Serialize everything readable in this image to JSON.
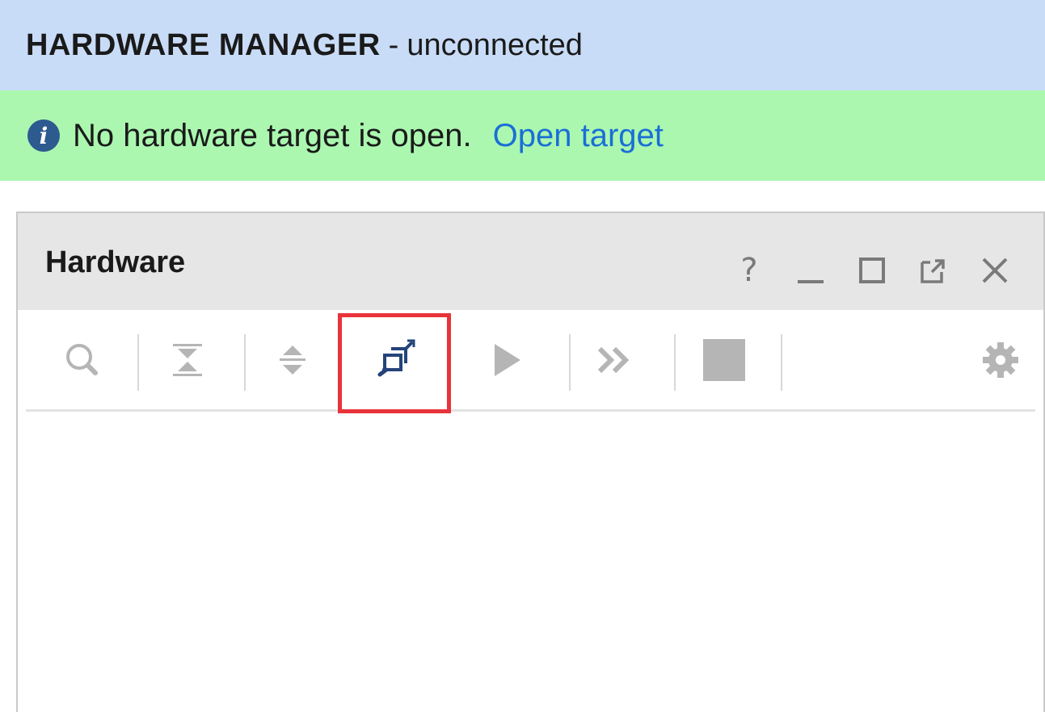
{
  "header": {
    "title": "HARDWARE MANAGER",
    "separator": "-",
    "status": "unconnected",
    "background_color": "#c9dcf7"
  },
  "info_bar": {
    "icon": "info-icon",
    "message": "No hardware target is open.",
    "link_text": "Open target",
    "background_color": "#abf7b0",
    "link_color": "#1a6fd6"
  },
  "hardware_panel": {
    "title": "Hardware",
    "window_controls": [
      {
        "name": "help-icon",
        "glyph": "?"
      },
      {
        "name": "minimize-icon"
      },
      {
        "name": "maximize-icon"
      },
      {
        "name": "float-icon"
      },
      {
        "name": "close-icon"
      }
    ],
    "toolbar": [
      {
        "name": "search-icon",
        "enabled": false
      },
      {
        "name": "collapse-all-icon",
        "enabled": false
      },
      {
        "name": "expand-all-icon",
        "enabled": false
      },
      {
        "name": "auto-connect-icon",
        "enabled": true,
        "highlighted": true
      },
      {
        "name": "run-trigger-icon",
        "enabled": false
      },
      {
        "name": "run-trigger-immediate-icon",
        "enabled": false
      },
      {
        "name": "stop-trigger-icon",
        "enabled": false
      },
      {
        "name": "settings-gear-icon",
        "enabled": false
      }
    ],
    "highlight_color": "#e8333a"
  }
}
